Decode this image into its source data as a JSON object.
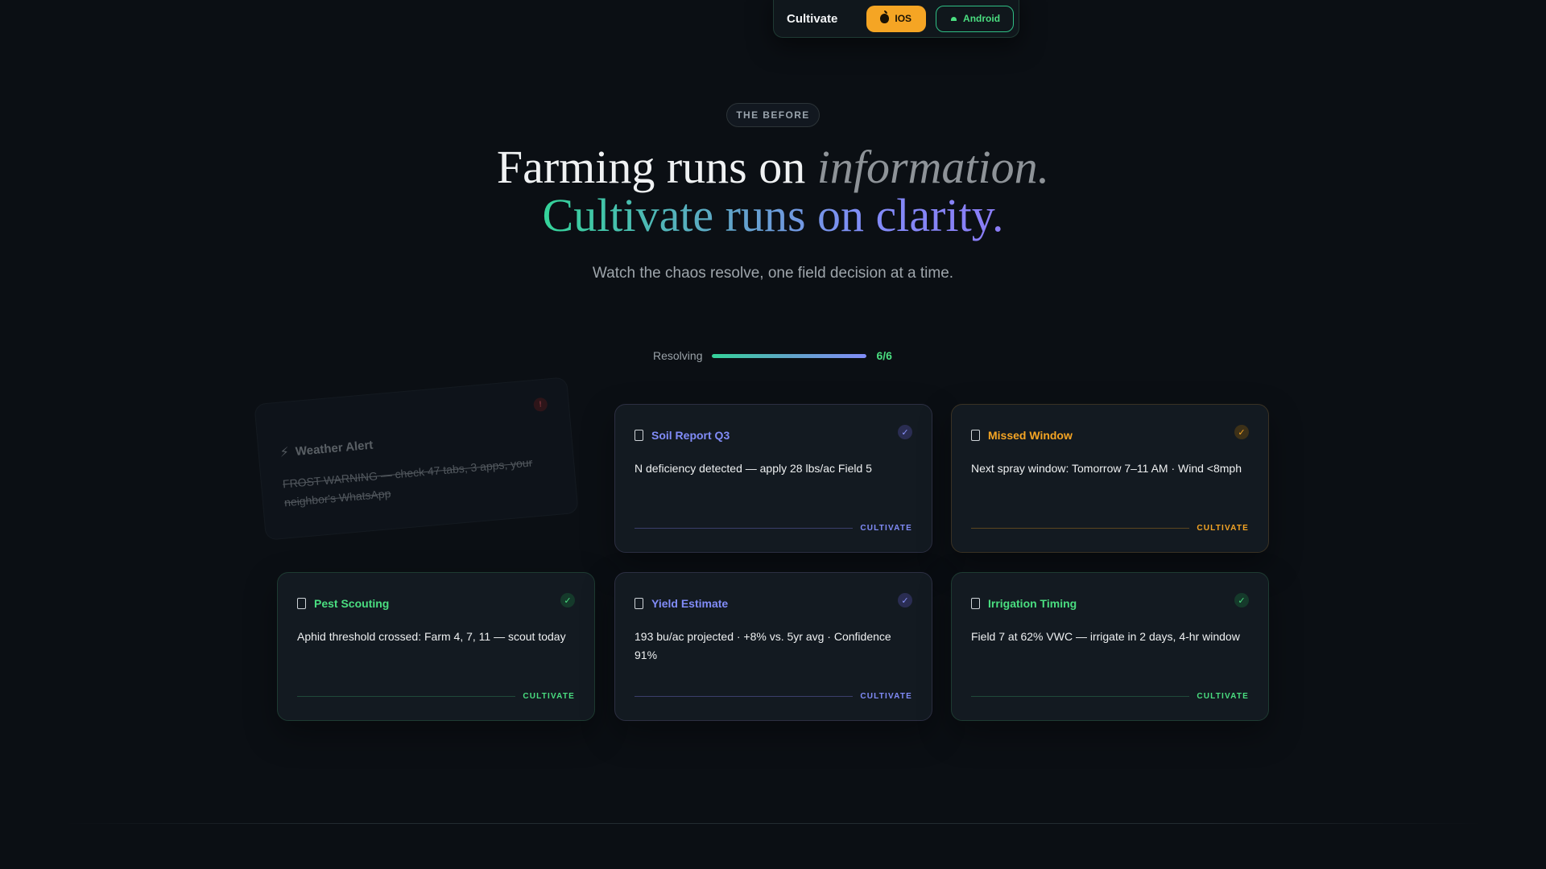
{
  "nav": {
    "brand": "Cultivate",
    "ios_label": "IOS",
    "android_label": "Android"
  },
  "hero": {
    "badge": "THE BEFORE",
    "line1_plain": "Farming runs on ",
    "line1_italic": "information.",
    "line2": "Cultivate runs on clarity.",
    "subtitle": "Watch the chaos resolve, one field decision at a time."
  },
  "progress": {
    "label": "Resolving",
    "count": "6/6",
    "fraction": 1.0
  },
  "ghost_card": {
    "title": "Weather Alert",
    "body": "FROST WARNING — check 47 tabs, 3 apps, your neighbor's WhatsApp",
    "icon": "bolt-icon",
    "alert_glyph": "!"
  },
  "cards": [
    {
      "title": "Soil Report Q3",
      "body": "N deficiency detected — apply 28 lbs/ac Field 5",
      "footer": "CULTIVATE",
      "accent": "#818cf8",
      "check": "✓"
    },
    {
      "title": "Missed Window",
      "body": "Next spray window: Tomorrow 7–11 AM · Wind <8mph",
      "footer": "CULTIVATE",
      "accent": "#f5a524",
      "check": "✓"
    },
    {
      "title": "Pest Scouting",
      "body": "Aphid threshold crossed: Farm 4, 7, 11 — scout today",
      "footer": "CULTIVATE",
      "accent": "#4ade80",
      "check": "✓"
    },
    {
      "title": "Yield Estimate",
      "body": "193 bu/ac projected · +8% vs. 5yr avg · Confidence 91%",
      "footer": "CULTIVATE",
      "accent": "#818cf8",
      "check": "✓"
    },
    {
      "title": "Irrigation Timing",
      "body": "Field 7 at 62% VWC — irrigate in 2 days, 4-hr window",
      "footer": "CULTIVATE",
      "accent": "#4ade80",
      "check": "✓"
    }
  ]
}
